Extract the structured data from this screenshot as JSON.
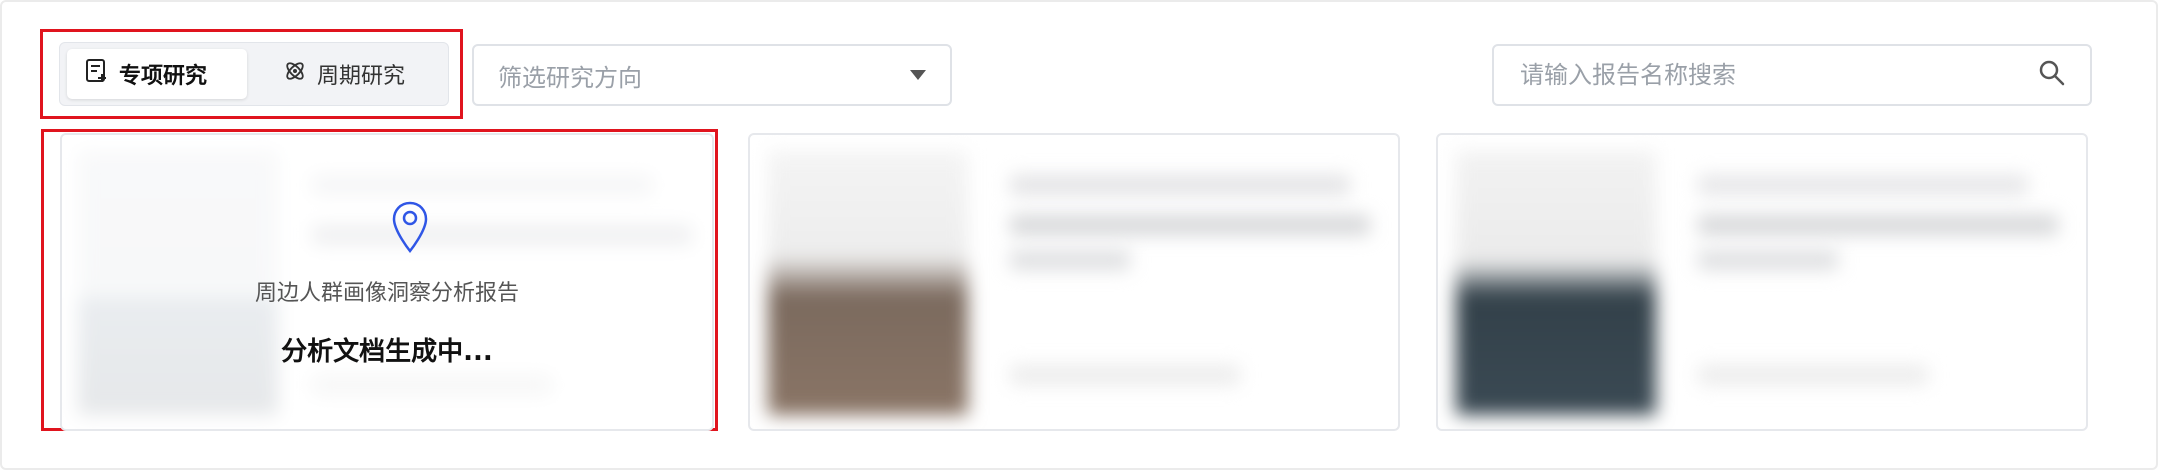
{
  "tabs": [
    {
      "label": "专项研究",
      "icon": "document-add-icon",
      "active": true
    },
    {
      "label": "周期研究",
      "icon": "atom-icon",
      "active": false
    }
  ],
  "filter": {
    "placeholder": "筛选研究方向",
    "icon": "caret-down-icon"
  },
  "search": {
    "placeholder": "请输入报告名称搜索",
    "icon": "search-icon"
  },
  "cards": [
    {
      "title": "周边人群画像洞察分析报告",
      "status": "分析文档生成中...",
      "icon": "location-pin-icon"
    },
    {
      "blurred": true
    },
    {
      "blurred": true
    }
  ],
  "colors": {
    "highlight": "#e0141e",
    "pin": "#2f56e6",
    "border": "#dfe2e7"
  }
}
